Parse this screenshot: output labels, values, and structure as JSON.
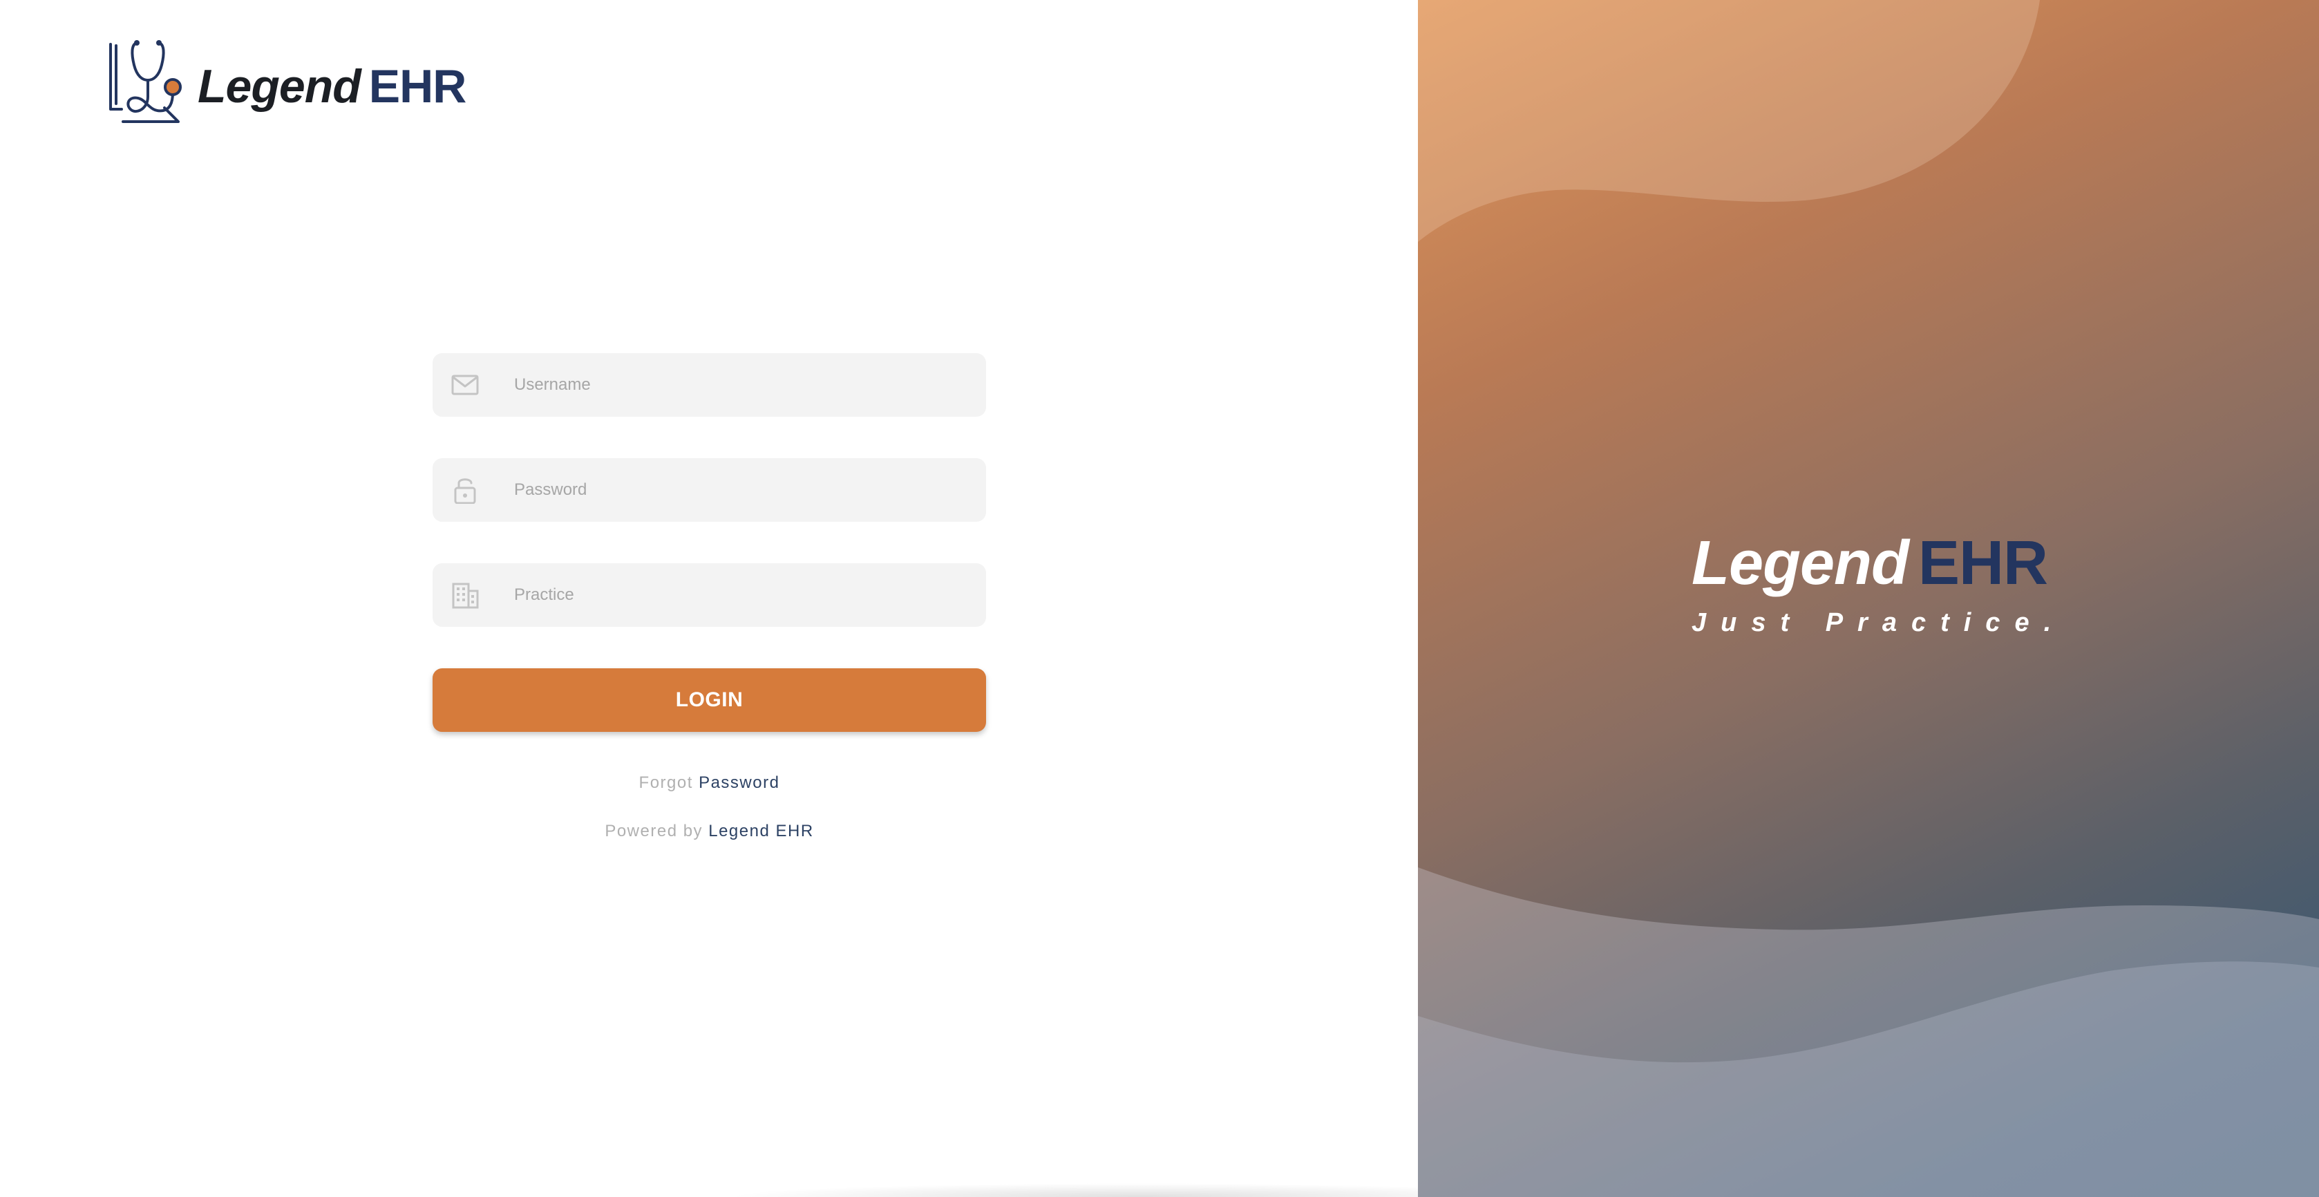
{
  "brand": {
    "name_part1": "Legend",
    "name_part2": "EHR"
  },
  "form": {
    "username": {
      "placeholder": "Username",
      "value": "",
      "icon": "mail-icon"
    },
    "password": {
      "placeholder": "Password",
      "value": "",
      "icon": "lock-icon"
    },
    "practice": {
      "placeholder": "Practice",
      "value": "",
      "icon": "building-icon"
    },
    "login_label": "LOGIN"
  },
  "links": {
    "forgot_prefix": "Forgot",
    "forgot_link": "Password",
    "powered_prefix": "Powered by",
    "powered_link": "Legend EHR"
  },
  "hero": {
    "title_part1": "Legend",
    "title_part2": "EHR",
    "tagline": "Just Practice."
  },
  "colors": {
    "accent": "#d67b3b",
    "brand_navy": "#23355f",
    "input_bg": "#f3f3f3",
    "link": "#2d4264"
  }
}
